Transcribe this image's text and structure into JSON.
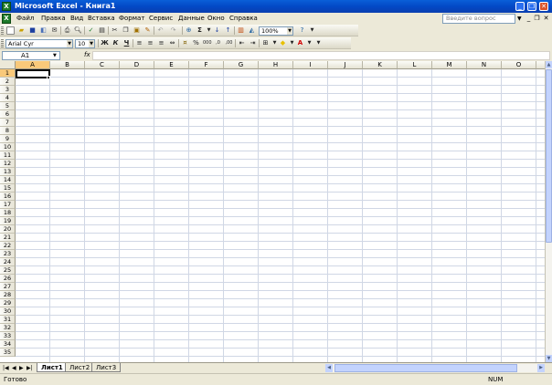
{
  "window": {
    "title": "Microsoft Excel - Книга1",
    "app_icon": "X"
  },
  "menu": {
    "items": [
      "Файл",
      "Правка",
      "Вид",
      "Вставка",
      "Формат",
      "Сервис",
      "Данные",
      "Окно",
      "Справка"
    ],
    "ask_placeholder": "Введите вопрос"
  },
  "std_toolbar": {
    "zoom": "100%"
  },
  "fmt_toolbar": {
    "font": "Arial Cyr",
    "size": "10"
  },
  "formula": {
    "cell_ref": "A1",
    "fx": "fx",
    "value": ""
  },
  "grid": {
    "columns": [
      "A",
      "B",
      "C",
      "D",
      "E",
      "F",
      "G",
      "H",
      "I",
      "J",
      "K",
      "L",
      "M",
      "N",
      "O"
    ],
    "rows": [
      "1",
      "2",
      "3",
      "4",
      "5",
      "6",
      "7",
      "8",
      "9",
      "10",
      "11",
      "12",
      "13",
      "14",
      "15",
      "16",
      "17",
      "18",
      "19",
      "20",
      "21",
      "22",
      "23",
      "24",
      "25",
      "26",
      "27",
      "28",
      "29",
      "30",
      "31",
      "32",
      "33",
      "34",
      "35"
    ],
    "active_cell": "A1"
  },
  "sheets": [
    "Лист1",
    "Лист2",
    "Лист3"
  ],
  "status": {
    "text": "Готово",
    "num": "NUM"
  }
}
